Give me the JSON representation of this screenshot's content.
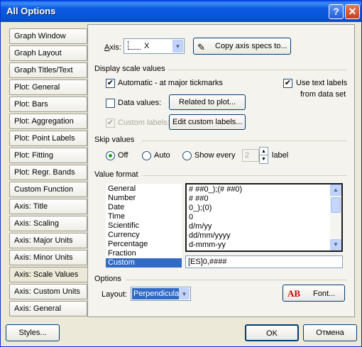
{
  "window": {
    "title": "All Options"
  },
  "sidebar": {
    "items": [
      {
        "label": "Graph Window"
      },
      {
        "label": "Graph Layout"
      },
      {
        "label": "Graph Titles/Text"
      },
      {
        "label": "Plot: General"
      },
      {
        "label": "Plot: Bars"
      },
      {
        "label": "Plot: Aggregation"
      },
      {
        "label": "Plot: Point Labels"
      },
      {
        "label": "Plot: Fitting"
      },
      {
        "label": "Plot: Regr. Bands"
      },
      {
        "label": "Custom Function"
      },
      {
        "label": "Axis: Title"
      },
      {
        "label": "Axis: Scaling"
      },
      {
        "label": "Axis: Major Units"
      },
      {
        "label": "Axis: Minor Units"
      },
      {
        "label": "Axis: Scale Values"
      },
      {
        "label": "Axis: Custom Units"
      },
      {
        "label": "Axis: General"
      }
    ],
    "active": "Axis: Scale Values"
  },
  "axis": {
    "label": "Axis:",
    "value": "X",
    "copy_button": "Copy axis specs to..."
  },
  "display_scale": {
    "header": "Display scale values",
    "automatic_label": "Automatic - at major tickmarks",
    "automatic_checked": true,
    "use_text_labels_1": "Use text labels",
    "use_text_labels_2": "from data set",
    "use_text_labels_checked": true,
    "data_values_label": "Data values:",
    "data_values_checked": false,
    "related_button": "Related to plot...",
    "custom_labels_label": "Custom labels:",
    "custom_labels_checked": true,
    "edit_custom_button": "Edit custom labels..."
  },
  "skip": {
    "header": "Skip values",
    "off": "Off",
    "auto": "Auto",
    "show_every": "Show every",
    "every_value": "2",
    "label_suffix": "label",
    "selected": "Off"
  },
  "value_format": {
    "header": "Value format",
    "categories": [
      "General",
      "Number",
      "Date",
      "Time",
      "Scientific",
      "Currency",
      "Percentage",
      "Fraction",
      "Custom"
    ],
    "selected_category": "Custom",
    "formats": [
      "# ##0_);(# ##0)",
      "# ##0",
      "0_);(0)",
      "0",
      "d/m/yy",
      "dd/mm/yyyy",
      "d-mmm-yy"
    ],
    "format_input": "[ES]0,####"
  },
  "options": {
    "header": "Options",
    "layout_label": "Layout:",
    "layout_value": "Perpendicular",
    "font_button": "Font..."
  },
  "footer": {
    "styles_button": "Styles...",
    "ok_button": "OK",
    "cancel_button": "Отмена"
  },
  "colors": {
    "title_bar": "#0b5be1",
    "selection": "#316ac5",
    "dialog_bg": "#ece9d8"
  }
}
